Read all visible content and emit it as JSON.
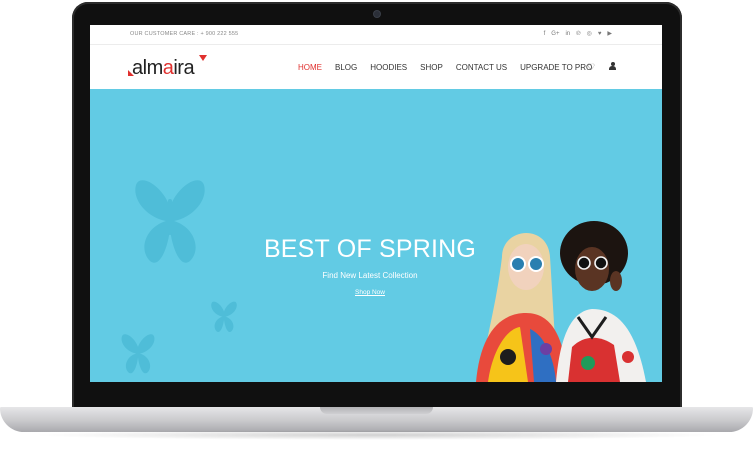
{
  "topbar": {
    "customer_care": "OUR CUSTOMER CARE : + 900 222 555",
    "social_icons": [
      "facebook-icon",
      "google-plus-icon",
      "linkedin-icon",
      "pinterest-icon",
      "instagram-icon",
      "twitter-icon",
      "youtube-icon"
    ],
    "social_glyphs": [
      "f",
      "G+",
      "in",
      "℗",
      "◎",
      "♥",
      "▶"
    ]
  },
  "brand": {
    "logo_text_a": "alm",
    "logo_text_b": "a",
    "logo_text_c": "ira",
    "accent": "#e0302e"
  },
  "nav": {
    "items": [
      {
        "label": "HOME",
        "active": true
      },
      {
        "label": "BLOG",
        "active": false
      },
      {
        "label": "HOODIES",
        "active": false
      },
      {
        "label": "SHOP",
        "active": false
      },
      {
        "label": "CONTACT US",
        "active": false
      },
      {
        "label": "UPGRADE TO PRO",
        "active": false
      }
    ],
    "wishlist_icon": "heart-icon",
    "account_icon": "user-icon"
  },
  "hero": {
    "title": "BEST OF SPRING",
    "subtitle": "Find New Latest Collection",
    "cta": "Shop Now",
    "background": "#62cbe4"
  }
}
